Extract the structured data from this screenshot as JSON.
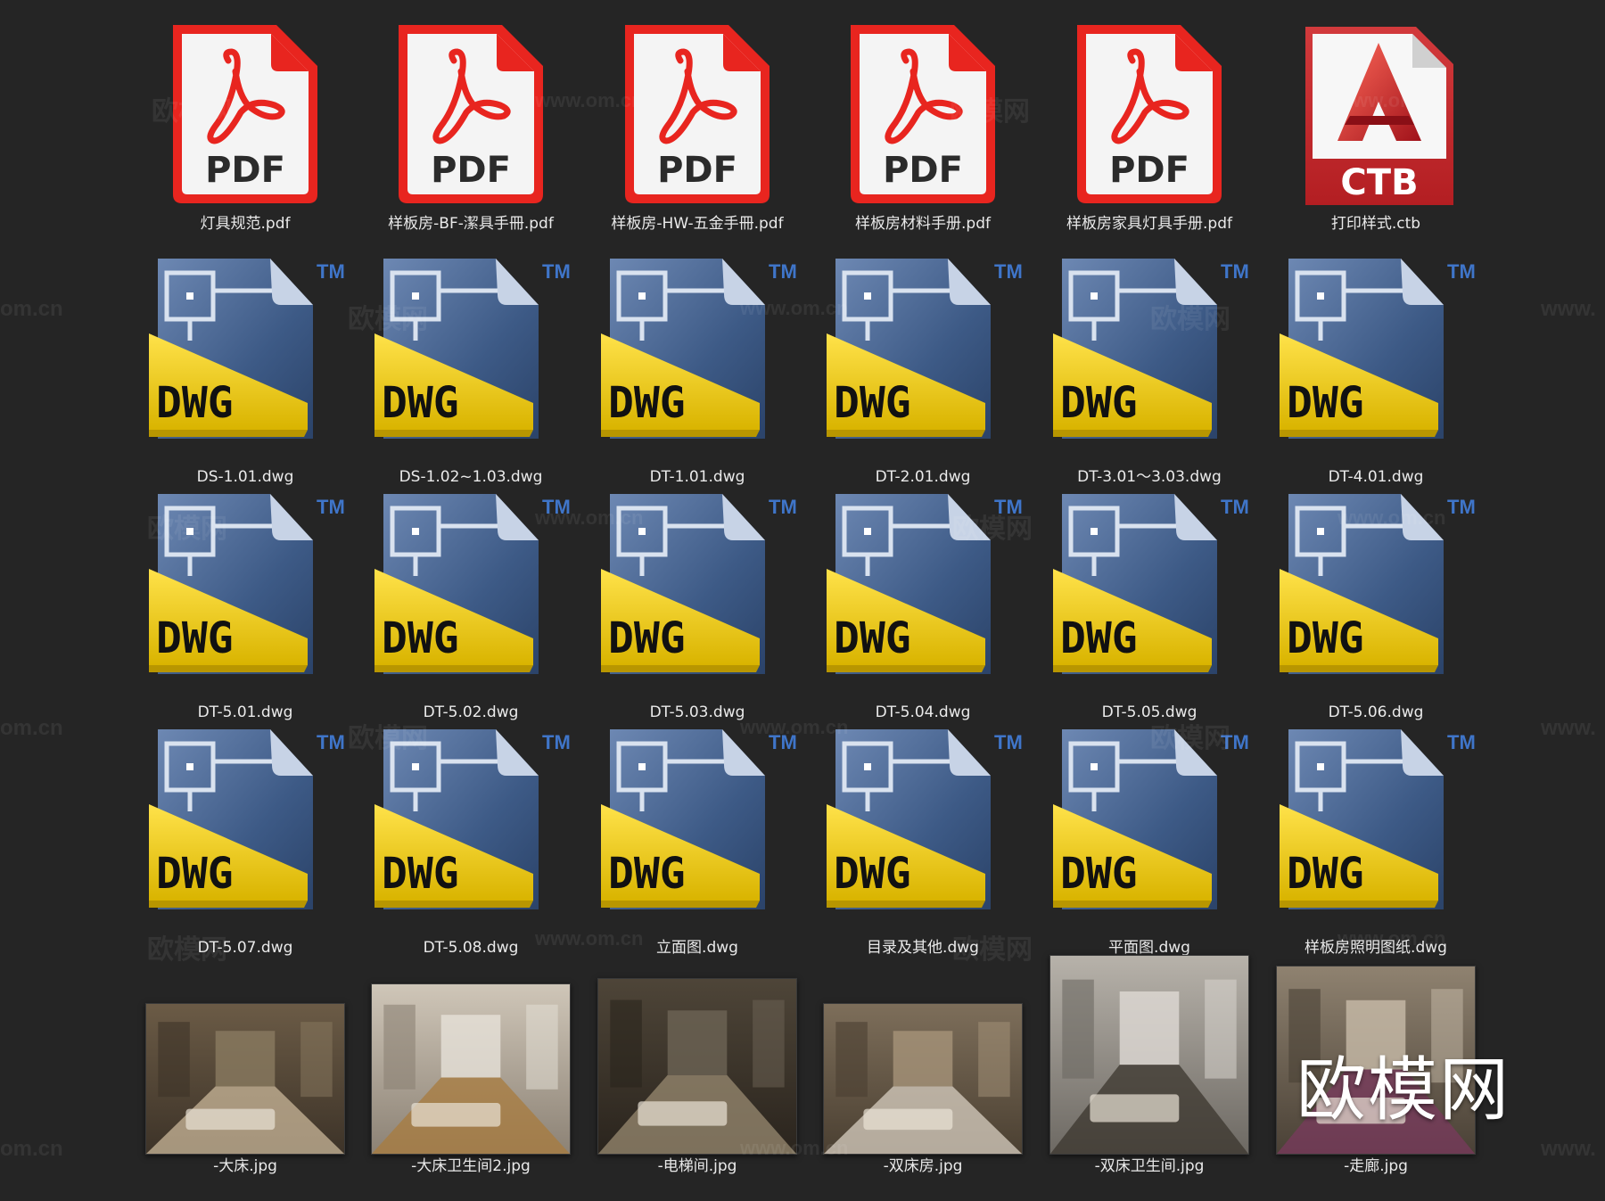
{
  "files": [
    {
      "name": "灯具规范.pdf",
      "type": "pdf",
      "icon": "pdf-file-icon"
    },
    {
      "name": "样板房-BF-潔具手冊.pdf",
      "type": "pdf",
      "icon": "pdf-file-icon"
    },
    {
      "name": "样板房-HW-五金手冊.pdf",
      "type": "pdf",
      "icon": "pdf-file-icon"
    },
    {
      "name": "样板房材料手册.pdf",
      "type": "pdf",
      "icon": "pdf-file-icon"
    },
    {
      "name": "样板房家具灯具手册.pdf",
      "type": "pdf",
      "icon": "pdf-file-icon"
    },
    {
      "name": "打印样式.ctb",
      "type": "ctb",
      "icon": "ctb-file-icon"
    },
    {
      "name": "DS-1.01.dwg",
      "type": "dwg",
      "icon": "dwg-file-icon"
    },
    {
      "name": "DS-1.02~1.03.dwg",
      "type": "dwg",
      "icon": "dwg-file-icon"
    },
    {
      "name": "DT-1.01.dwg",
      "type": "dwg",
      "icon": "dwg-file-icon"
    },
    {
      "name": "DT-2.01.dwg",
      "type": "dwg",
      "icon": "dwg-file-icon"
    },
    {
      "name": "DT-3.01～3.03.dwg",
      "type": "dwg",
      "icon": "dwg-file-icon"
    },
    {
      "name": "DT-4.01.dwg",
      "type": "dwg",
      "icon": "dwg-file-icon"
    },
    {
      "name": "DT-5.01.dwg",
      "type": "dwg",
      "icon": "dwg-file-icon"
    },
    {
      "name": "DT-5.02.dwg",
      "type": "dwg",
      "icon": "dwg-file-icon"
    },
    {
      "name": "DT-5.03.dwg",
      "type": "dwg",
      "icon": "dwg-file-icon"
    },
    {
      "name": "DT-5.04.dwg",
      "type": "dwg",
      "icon": "dwg-file-icon"
    },
    {
      "name": "DT-5.05.dwg",
      "type": "dwg",
      "icon": "dwg-file-icon"
    },
    {
      "name": "DT-5.06.dwg",
      "type": "dwg",
      "icon": "dwg-file-icon"
    },
    {
      "name": "DT-5.07.dwg",
      "type": "dwg",
      "icon": "dwg-file-icon"
    },
    {
      "name": "DT-5.08.dwg",
      "type": "dwg",
      "icon": "dwg-file-icon"
    },
    {
      "name": "立面图.dwg",
      "type": "dwg",
      "icon": "dwg-file-icon"
    },
    {
      "name": "目录及其他.dwg",
      "type": "dwg",
      "icon": "dwg-file-icon"
    },
    {
      "name": "平面图.dwg",
      "type": "dwg",
      "icon": "dwg-file-icon"
    },
    {
      "name": "样板房照明图纸.dwg",
      "type": "dwg",
      "icon": "dwg-file-icon"
    },
    {
      "name": "-大床.jpg",
      "type": "jpg",
      "icon": "image-thumbnail",
      "scene": "bedroom"
    },
    {
      "name": "-大床卫生间2.jpg",
      "type": "jpg",
      "icon": "image-thumbnail",
      "scene": "bathroom"
    },
    {
      "name": "-电梯间.jpg",
      "type": "jpg",
      "icon": "image-thumbnail",
      "scene": "corridor"
    },
    {
      "name": "-双床房.jpg",
      "type": "jpg",
      "icon": "image-thumbnail",
      "scene": "twin-room"
    },
    {
      "name": "-双床卫生间.jpg",
      "type": "jpg",
      "icon": "image-thumbnail",
      "scene": "bathroom-tall"
    },
    {
      "name": "-走廊.jpg",
      "type": "jpg",
      "icon": "image-thumbnail",
      "scene": "hallway"
    }
  ],
  "icon_text": {
    "pdf": "PDF",
    "ctb": "CTB",
    "dwg": "DWG",
    "tm": "TM"
  },
  "colors": {
    "background": "#252525",
    "pdf_red": "#e8251f",
    "ctb_red": "#b31e22",
    "dwg_blue": "#3d5a86",
    "dwg_yellow": "#f2cf12"
  },
  "watermarks": [
    "欧模网",
    "www.om.cn",
    "om.cn",
    "www."
  ],
  "brand": "欧模网"
}
